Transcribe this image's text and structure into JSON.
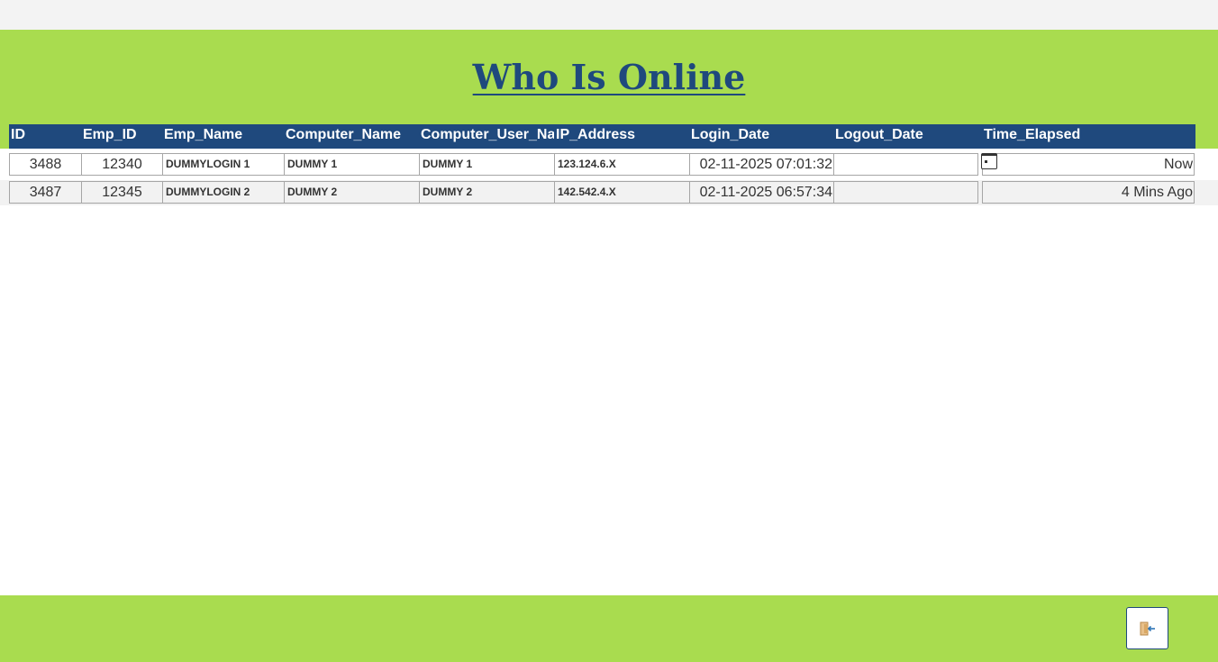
{
  "page": {
    "title": "Who Is Online"
  },
  "table": {
    "columns": [
      "ID",
      "Emp_ID",
      "Emp_Name",
      "Computer_Name",
      "Computer_User_Name",
      "IP_Address",
      "Login_Date",
      "Logout_Date",
      "Time_Elapsed"
    ],
    "rows": [
      {
        "id": "3488",
        "emp_id": "12340",
        "emp_name": "DUMMYLOGIN 1",
        "computer_name": "DUMMY 1",
        "computer_user_name": "DUMMY 1",
        "ip_address": "123.124.6.X",
        "login_date": "02-11-2025 07:01:32",
        "logout_date": "",
        "time_elapsed": "Now",
        "logout_icon": "calendar-icon"
      },
      {
        "id": "3487",
        "emp_id": "12345",
        "emp_name": "DUMMYLOGIN 2",
        "computer_name": "DUMMY 2",
        "computer_user_name": "DUMMY 2",
        "ip_address": "142.542.4.X",
        "login_date": "02-11-2025 06:57:34",
        "logout_date": "",
        "time_elapsed": "4 Mins Ago"
      }
    ]
  },
  "footer": {
    "exit_icon": "exit-door-icon"
  },
  "colors": {
    "brand_green": "#a9dc4f",
    "header_blue": "#1f497d",
    "row_alt": "#f2f2f2"
  }
}
